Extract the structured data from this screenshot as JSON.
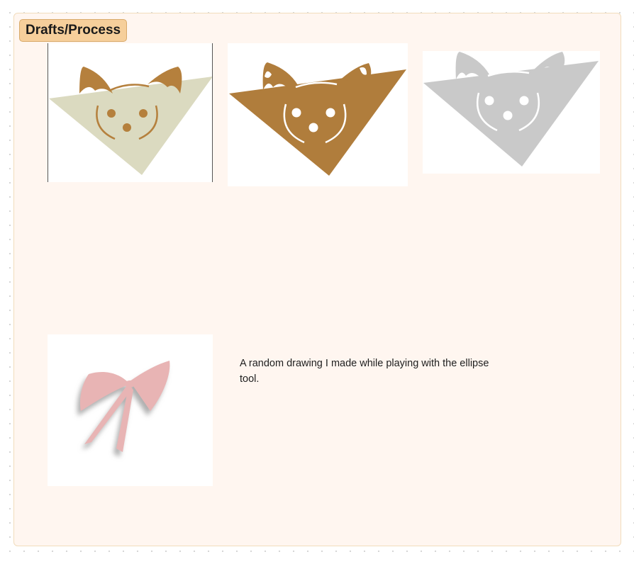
{
  "section": {
    "label": "Drafts/Process",
    "background": "#fff6f0",
    "border": "#f1dcbc",
    "label_background": "#f6cf9b"
  },
  "drafts": [
    {
      "name": "dog-face-draft-beige",
      "triangle_color": "#dbdac0",
      "feature_color": "#b5803d"
    },
    {
      "name": "dog-face-draft-brown",
      "triangle_color": "#b07d3c",
      "feature_color": "#ffffff"
    },
    {
      "name": "dog-face-draft-gray",
      "triangle_color": "#c9c9c9",
      "feature_color": "#ffffff"
    }
  ],
  "bow_drawing": {
    "color": "#e8b4b4",
    "shadow": "#b8b8b8"
  },
  "note": {
    "text": "A random drawing I made while playing with the ellipse tool."
  }
}
